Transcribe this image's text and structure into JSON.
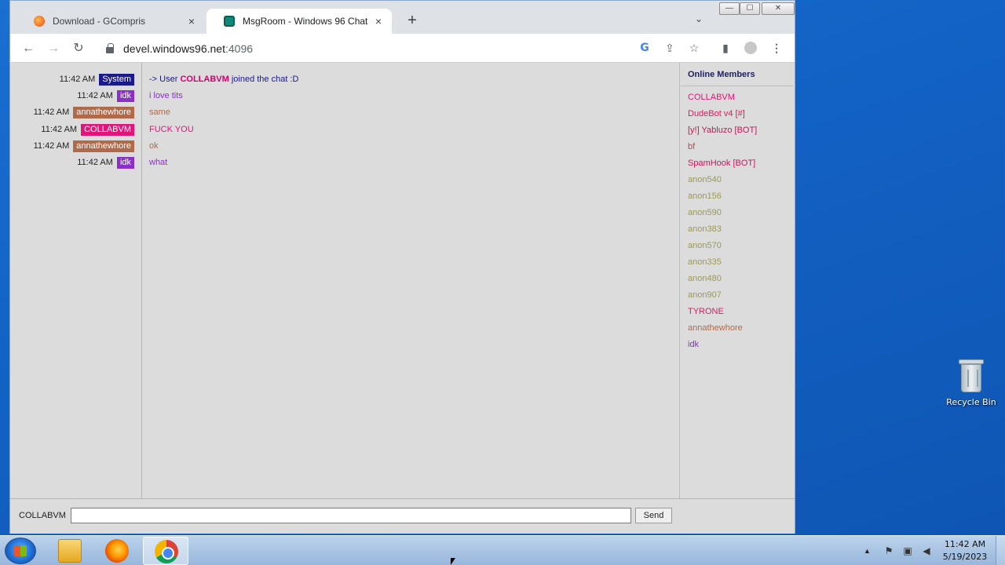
{
  "desktop": {
    "recycle_bin_label": "Recycle Bin"
  },
  "browser": {
    "tabs": [
      {
        "title": "Download - GCompris",
        "active": false
      },
      {
        "title": "MsgRoom - Windows 96 Chat",
        "active": true
      }
    ],
    "url_host": "devel.windows96.net",
    "url_port": ":4096",
    "icons": {
      "close": "×",
      "new_tab": "+",
      "tab_list": "⌄",
      "back": "←",
      "forward": "→",
      "reload": "↻",
      "google": "G",
      "share": "⇪",
      "star": "☆",
      "side_panel": "▮",
      "menu": "⋮",
      "minimize": "—",
      "maximize": "☐",
      "close_window": "✕"
    }
  },
  "chat": {
    "messages": [
      {
        "time": "11:42 AM",
        "nick": "System",
        "nick_bg": "#1a1a8c",
        "text_prefix": "-> User ",
        "text_nick": "COLLABVM",
        "text": " joined the chat :D",
        "text_color": "#1a1a8c"
      },
      {
        "time": "11:42 AM",
        "nick": "idk",
        "nick_bg": "#8b2fc9",
        "text": "i love tits",
        "text_color": "#8b2fc9"
      },
      {
        "time": "11:42 AM",
        "nick": "annathewhore",
        "nick_bg": "#b06a4a",
        "text": "same",
        "text_color": "#b06a4a"
      },
      {
        "time": "11:42 AM",
        "nick": "COLLABVM",
        "nick_bg": "#e0157a",
        "text": "FUCK YOU",
        "text_color": "#e0157a"
      },
      {
        "time": "11:42 AM",
        "nick": "annathewhore",
        "nick_bg": "#b06a4a",
        "text": "ok",
        "text_color": "#b06a4a"
      },
      {
        "time": "11:42 AM",
        "nick": "idk",
        "nick_bg": "#8b2fc9",
        "text": "what",
        "text_color": "#8b2fc9"
      }
    ],
    "members_title": "Online Members",
    "members": [
      {
        "name": "COLLABVM",
        "color": "#e0157a"
      },
      {
        "name": "DudeBot v4 [#]",
        "color": "#d81b60"
      },
      {
        "name": "[y!] Yabluzo [BOT]",
        "color": "#c2185b"
      },
      {
        "name": "bf",
        "color": "#a0525a"
      },
      {
        "name": "SpamHook [BOT]",
        "color": "#c2185b"
      },
      {
        "name": "anon540",
        "color": "#9e9a4a"
      },
      {
        "name": "anon156",
        "color": "#9e9a4a"
      },
      {
        "name": "anon590",
        "color": "#9e9a4a"
      },
      {
        "name": "anon383",
        "color": "#9e9a4a"
      },
      {
        "name": "anon570",
        "color": "#9e9a4a"
      },
      {
        "name": "anon335",
        "color": "#9e9a4a"
      },
      {
        "name": "anon480",
        "color": "#9e9a4a"
      },
      {
        "name": "anon907",
        "color": "#9e9a4a"
      },
      {
        "name": "TYRONE",
        "color": "#d81b60"
      },
      {
        "name": "annathewhore",
        "color": "#b06a4a"
      },
      {
        "name": "idk",
        "color": "#8b2fc9"
      }
    ],
    "current_user": "COLLABVM",
    "input_value": "",
    "send_label": "Send"
  },
  "taskbar": {
    "clock_time": "11:42 AM",
    "clock_date": "5/19/2023",
    "tray_arrow": "▲"
  }
}
